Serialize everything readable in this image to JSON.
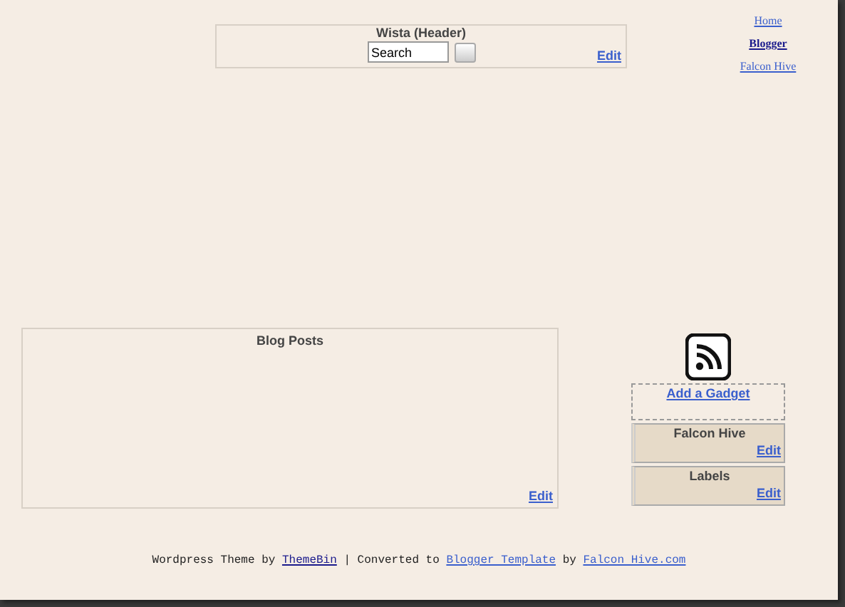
{
  "header": {
    "title": "Wista (Header)",
    "search": {
      "value": "Search"
    },
    "edit": "Edit"
  },
  "nav": [
    {
      "label": "Home",
      "visited": false,
      "selected": false
    },
    {
      "label": "Blogger",
      "visited": true,
      "selected": true
    },
    {
      "label": "Falcon Hive",
      "visited": false,
      "selected": false
    }
  ],
  "main": {
    "title": "Blog Posts",
    "edit": "Edit"
  },
  "sidebar": {
    "add_gadget": "Add a Gadget",
    "gadgets": [
      {
        "title": "Falcon Hive",
        "edit": "Edit"
      },
      {
        "title": "Labels",
        "edit": "Edit"
      }
    ]
  },
  "footer": [
    {
      "kind": "text",
      "text": "Wordpress Theme by "
    },
    {
      "kind": "link",
      "text": "ThemeBin",
      "visited": true
    },
    {
      "kind": "text",
      "text": " | Converted to "
    },
    {
      "kind": "link",
      "text": "Blogger Template",
      "visited": false
    },
    {
      "kind": "text",
      "text": " by "
    },
    {
      "kind": "link",
      "text": "Falcon Hive.com",
      "visited": false
    }
  ]
}
